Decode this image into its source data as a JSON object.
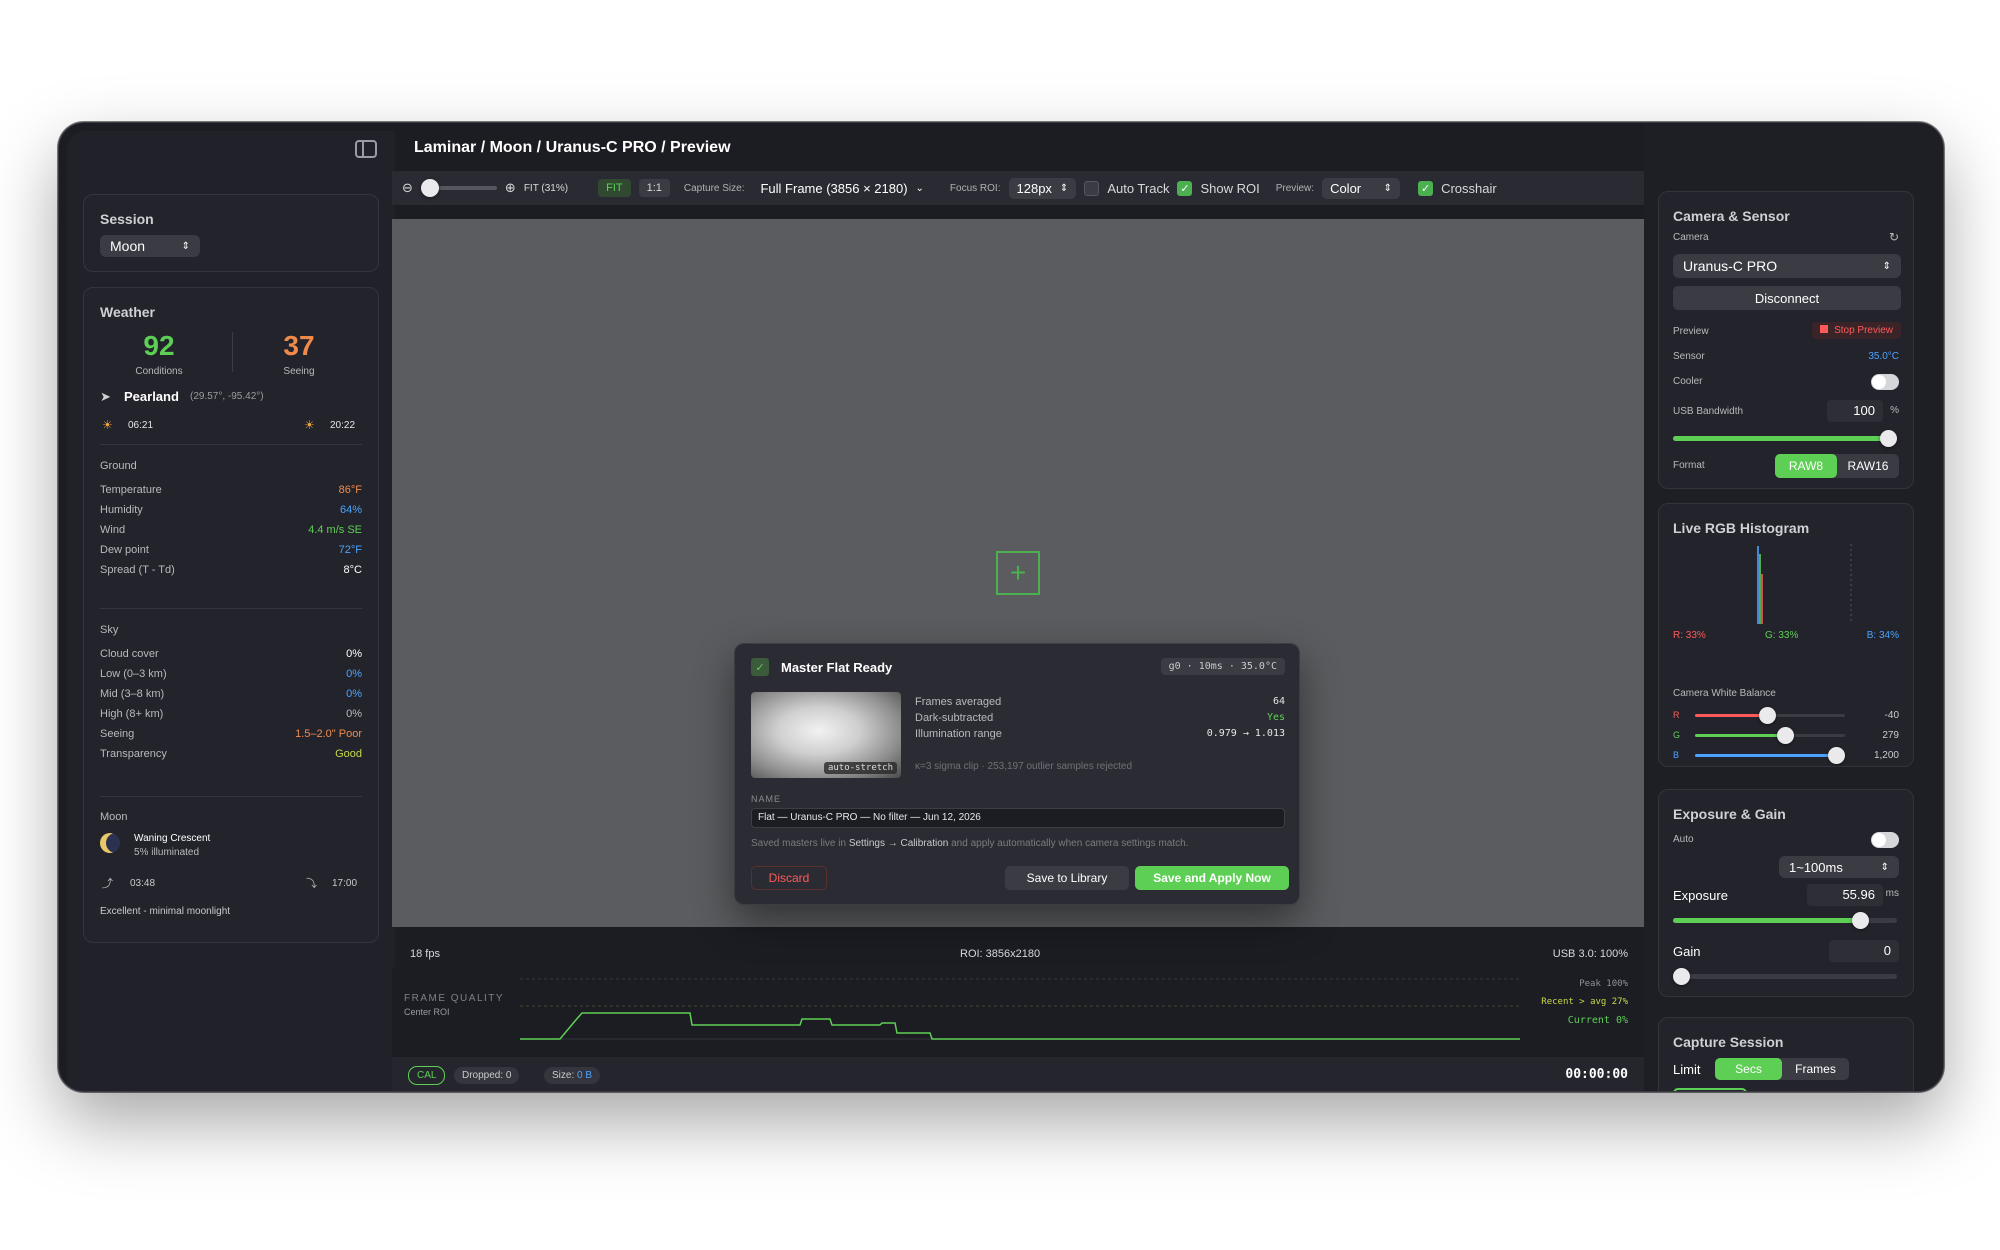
{
  "colors": {
    "green": "#5ecf55",
    "orange": "#f08a4b",
    "blue": "#4aa3ff",
    "red": "#ff5f57",
    "yellow": "#febc2e",
    "lightgreen": "#28c840"
  },
  "breadcrumb": "Laminar / Moon / Uranus-C PRO / Preview",
  "session": {
    "title": "Session",
    "value": "Moon"
  },
  "weather": {
    "title": "Weather",
    "conditions": {
      "value": "92",
      "label": "Conditions"
    },
    "seeing": {
      "value": "37",
      "label": "Seeing"
    },
    "location": "Pearland",
    "coords": "(29.57°, -95.42°)",
    "sunrise": "06:21",
    "sunset": "20:22",
    "ground": {
      "title": "Ground",
      "rows": [
        {
          "label": "Temperature",
          "value": "86°F",
          "color": "#f08a4b"
        },
        {
          "label": "Humidity",
          "value": "64%",
          "color": "#4aa3ff"
        },
        {
          "label": "Wind",
          "value": "4.4 m/s SE",
          "color": "#5ecf55"
        },
        {
          "label": "Dew point",
          "value": "72°F",
          "color": "#4aa3ff"
        },
        {
          "label": "Spread (T - Td)",
          "value": "8°C",
          "color": "#ffffff"
        }
      ]
    },
    "sky": {
      "title": "Sky",
      "rows": [
        {
          "label": "Cloud cover",
          "value": "0%",
          "color": "#ffffff"
        },
        {
          "label": "Low (0–3 km)",
          "value": "0%",
          "color": "#4aa3ff"
        },
        {
          "label": "Mid (3–8 km)",
          "value": "0%",
          "color": "#4aa3ff"
        },
        {
          "label": "High (8+ km)",
          "value": "0%",
          "color": "#b8b9be"
        },
        {
          "label": "Seeing",
          "value": "1.5–2.0\"  Poor",
          "color": "#f08a4b"
        },
        {
          "label": "Transparency",
          "value": "Good",
          "color": "#c8d84a"
        }
      ]
    },
    "moon": {
      "title": "Moon",
      "phase": "Waning Crescent",
      "illum": "5% illuminated",
      "rise": "03:48",
      "set": "17:00",
      "note": "Excellent - minimal moonlight"
    }
  },
  "toolbar": {
    "zoom_label": "FIT (31%)",
    "fit": "FIT",
    "one": "1:1",
    "capture_label": "Capture Size:",
    "capture_value": "Full Frame (3856 × 2180)",
    "focus_label": "Focus ROI:",
    "focus_value": "128px",
    "auto_track": "Auto Track",
    "show_roi": "Show ROI",
    "preview_label": "Preview:",
    "preview_value": "Color",
    "crosshair": "Crosshair"
  },
  "modal": {
    "title": "Master Flat Ready",
    "badge": "g0 · 10ms · 35.0°C",
    "thumb_label": "auto-stretch",
    "stats": [
      {
        "label": "Frames averaged",
        "value": "64",
        "color": "#e6e6e8"
      },
      {
        "label": "Dark-subtracted",
        "value": "Yes",
        "color": "#5ecf55"
      },
      {
        "label": "Illumination range",
        "value": "0.979 → 1.013",
        "color": "#e6e6e8"
      }
    ],
    "clip_note": "κ=3 sigma clip · 253,197 outlier samples rejected",
    "name_label": "NAME",
    "name_value": "Flat — Uranus-C PRO — No filter — Jun 12, 2026",
    "hint_pre": "Saved masters live in",
    "hint_link": "Settings → Calibration",
    "hint_post": "and apply automatically when camera settings match.",
    "discard": "Discard",
    "save_lib": "Save to Library",
    "save_apply": "Save and Apply Now"
  },
  "status": {
    "fps": "18 fps",
    "roi": "ROI: 3856x2180",
    "usb": "USB 3.0: 100%"
  },
  "frame_quality": {
    "title": "FRAME QUALITY",
    "sub": "Center ROI",
    "peak": "Peak 100%",
    "recent": "Recent > avg 27%",
    "current": "Current 0%"
  },
  "bottombar": {
    "cal": "CAL",
    "dropped": "Dropped: 0",
    "size_label": "Size:",
    "size_value": "0 B",
    "timer": "00:00:00"
  },
  "camera": {
    "title": "Camera & Sensor",
    "camera_label": "Camera",
    "camera_value": "Uranus-C PRO",
    "disconnect": "Disconnect",
    "preview_label": "Preview",
    "stop_preview": "Stop Preview",
    "sensor_label": "Sensor",
    "sensor_value": "35.0°C",
    "cooler_label": "Cooler",
    "usb_label": "USB Bandwidth",
    "usb_value": "100",
    "usb_unit": "%",
    "usb_level": 1.0,
    "format_label": "Format",
    "format_a": "RAW8",
    "format_b": "RAW16"
  },
  "histogram": {
    "title": "Live RGB Histogram",
    "r": "R: 33%",
    "g": "G: 33%",
    "b": "B: 34%",
    "wb_title": "Camera White Balance",
    "wb": [
      {
        "ch": "R",
        "value": "-40",
        "color": "#ff5a5a",
        "level": 0.48
      },
      {
        "ch": "G",
        "value": "279",
        "color": "#5ecf55",
        "level": 0.6
      },
      {
        "ch": "B",
        "value": "1,200",
        "color": "#4aa3ff",
        "level": 0.94
      }
    ]
  },
  "exposure": {
    "title": "Exposure & Gain",
    "auto": "Auto",
    "range": "1~100ms",
    "exp_label": "Exposure",
    "exp_value": "55.96",
    "exp_unit": "ms",
    "exp_level": 0.84,
    "gain_label": "Gain",
    "gain_value": "0",
    "gain_level": 0.0
  },
  "capture": {
    "title": "Capture Session",
    "limit": "Limit",
    "secs": "Secs",
    "frames": "Frames"
  }
}
